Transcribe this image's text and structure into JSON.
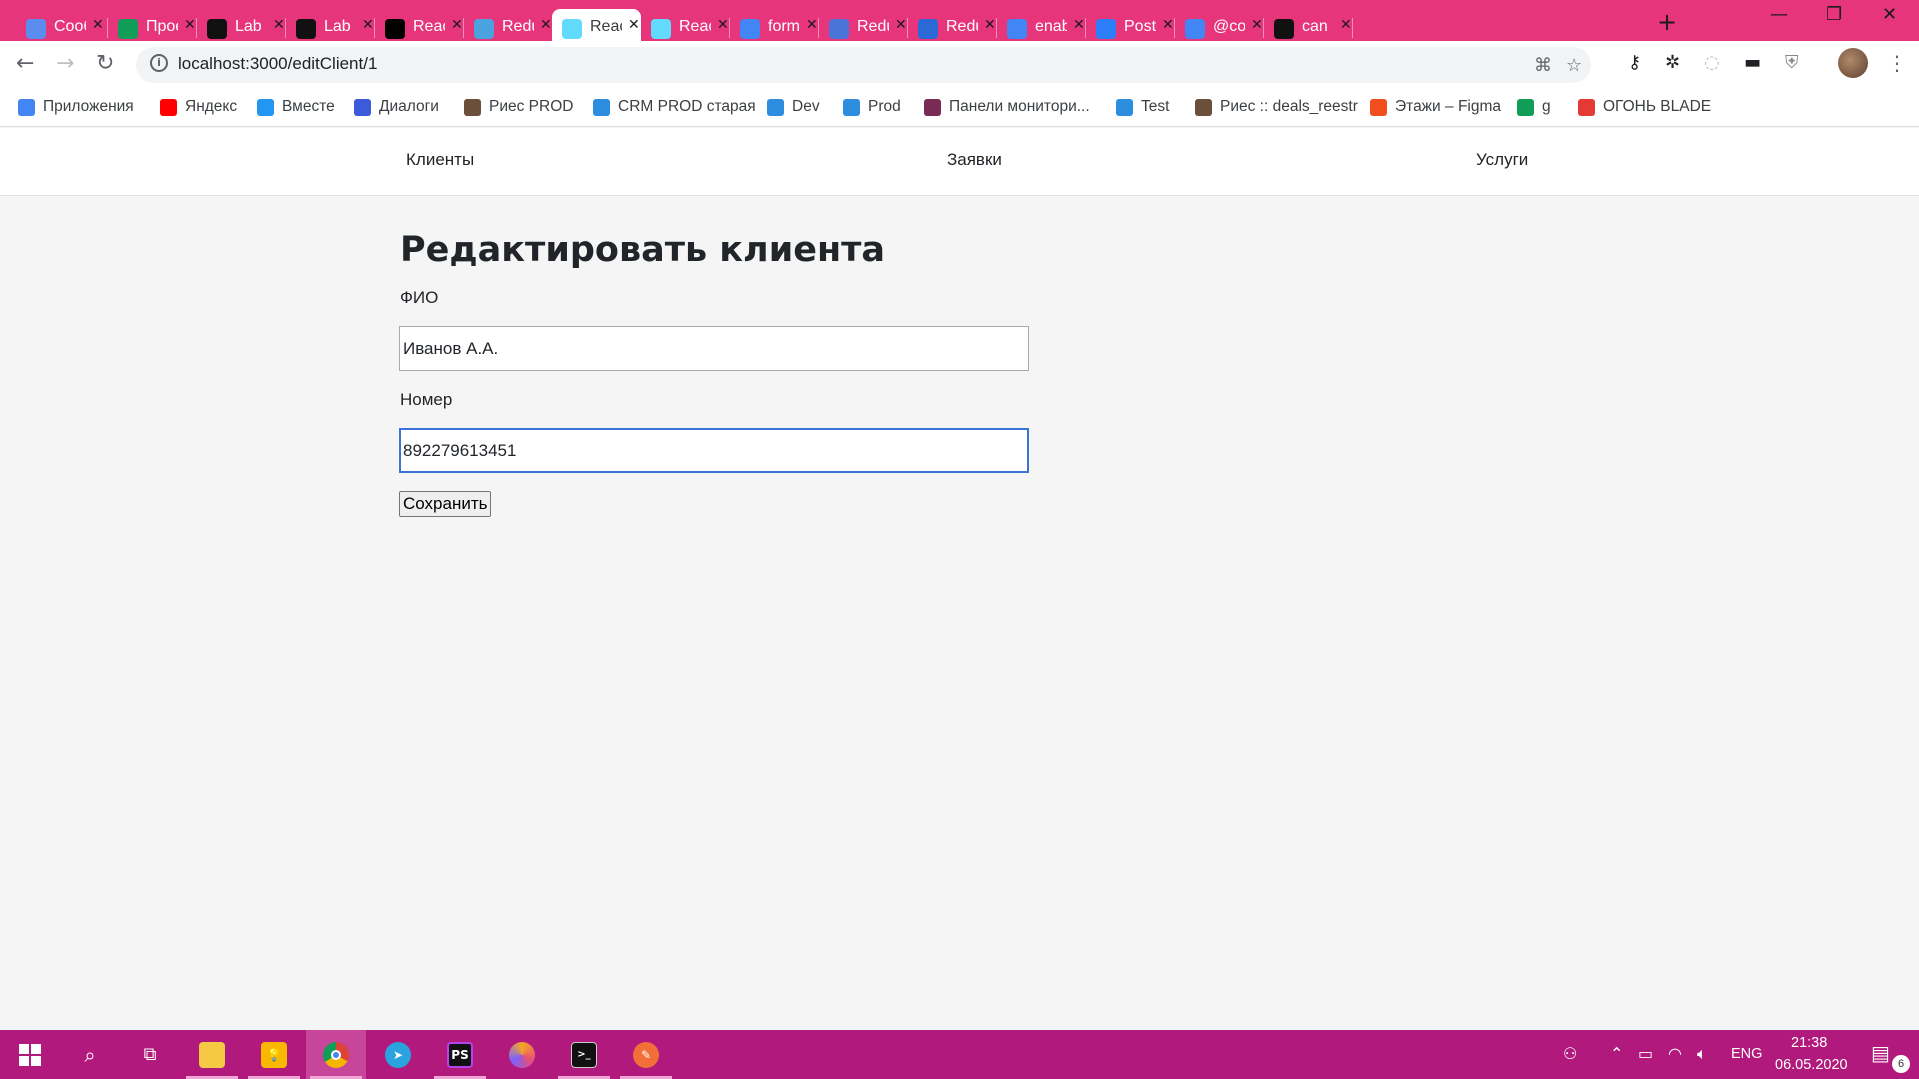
{
  "browser": {
    "tabs": [
      {
        "title": "Сообщения",
        "icon": "chat-icon",
        "color": "#5b8def"
      },
      {
        "title": "Проекты",
        "icon": "sheets-plus-icon",
        "color": "#0f9d58"
      },
      {
        "title": "Lab",
        "icon": "lab-icon",
        "color": "#111111"
      },
      {
        "title": "Lab",
        "icon": "lab-icon",
        "color": "#111111"
      },
      {
        "title": "React",
        "icon": "medium-icon",
        "color": "#000000"
      },
      {
        "title": "Redux",
        "icon": "butterfly-icon",
        "color": "#4aa3df"
      },
      {
        "title": "React",
        "icon": "react-icon",
        "color": "#61dafb",
        "active": true
      },
      {
        "title": "React",
        "icon": "react-icon",
        "color": "#61dafb"
      },
      {
        "title": "form",
        "icon": "google-icon",
        "color": "#4285f4"
      },
      {
        "title": "Redux",
        "icon": "translate-icon",
        "color": "#4a73d8"
      },
      {
        "title": "Redux",
        "icon": "opera-icon",
        "color": "#2b6ad6"
      },
      {
        "title": "enable",
        "icon": "google-icon",
        "color": "#4285f4"
      },
      {
        "title": "Post",
        "icon": "question-icon",
        "color": "#2d7ff9"
      },
      {
        "title": "@co",
        "icon": "google-icon",
        "color": "#4285f4"
      },
      {
        "title": "can",
        "icon": "github-icon",
        "color": "#111111"
      }
    ],
    "url": "localhost:3000/editClient/1",
    "bookmarks": [
      {
        "label": "Приложения",
        "icon": "apps-grid-icon",
        "color": "#4285f4"
      },
      {
        "label": "Яндекс",
        "icon": "yandex-icon",
        "color": "#ff0000"
      },
      {
        "label": "Вместе",
        "icon": "vmeste-icon",
        "color": "#2196f3"
      },
      {
        "label": "Диалоги",
        "icon": "chat-icon",
        "color": "#3b5bdb"
      },
      {
        "label": "Риес PROD",
        "icon": "ries-icon",
        "color": "#6b4f3a"
      },
      {
        "label": "CRM PROD старая",
        "icon": "cube-icon",
        "color": "#2d8ee0"
      },
      {
        "label": "Dev",
        "icon": "cube-icon",
        "color": "#2d8ee0"
      },
      {
        "label": "Prod",
        "icon": "cube-icon",
        "color": "#2d8ee0"
      },
      {
        "label": "Панели монитори...",
        "icon": "monitoring-icon",
        "color": "#7a2b55"
      },
      {
        "label": "Test",
        "icon": "cube-icon",
        "color": "#2d8ee0"
      },
      {
        "label": "Риес :: deals_reestr",
        "icon": "ries-icon",
        "color": "#6b4f3a"
      },
      {
        "label": "Этажи – Figma",
        "icon": "figma-icon",
        "color": "#f24e1e"
      },
      {
        "label": "g",
        "icon": "sheets-plus-icon",
        "color": "#0f9d58"
      },
      {
        "label": "ОГОНЬ BLADE",
        "icon": "fire-icon",
        "color": "#e53935"
      }
    ]
  },
  "app": {
    "nav": {
      "clients": "Клиенты",
      "requests": "Заявки",
      "services": "Услуги"
    },
    "form": {
      "title": "Редактировать клиента",
      "name_label": "ФИО",
      "name_value": "Иванов А.А.",
      "phone_label": "Номер",
      "phone_value": "892279613451",
      "save_label": "Сохранить"
    }
  },
  "taskbar": {
    "lang": "ENG",
    "time": "21:38",
    "date": "06.05.2020",
    "notifications": "6",
    "accent_color": "#b1197c"
  }
}
